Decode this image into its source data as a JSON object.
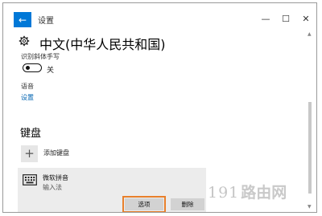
{
  "window": {
    "title": "设置",
    "back_glyph": "←",
    "controls": {
      "minimize": "—",
      "maximize": "☐",
      "close": "✕"
    }
  },
  "page": {
    "title": "中文(中华人民共和国)",
    "icon": "gear-icon"
  },
  "handwriting": {
    "label": "识别斜体手写",
    "toggle_state": "关",
    "toggle_on": false
  },
  "speech": {
    "label": "语音",
    "link": "设置"
  },
  "keyboard": {
    "heading": "键盘",
    "add_glyph": "+",
    "add_label": "添加键盘",
    "installed": {
      "name": "微软拼音",
      "type": "输入法",
      "icon": "keyboard-icon",
      "options_label": "选项",
      "remove_label": "删除"
    }
  },
  "watermark": {
    "digits": "191",
    "chars": "路由网"
  },
  "colors": {
    "accent": "#0078d7",
    "link": "#0063b1",
    "highlight": "#e8802c"
  }
}
